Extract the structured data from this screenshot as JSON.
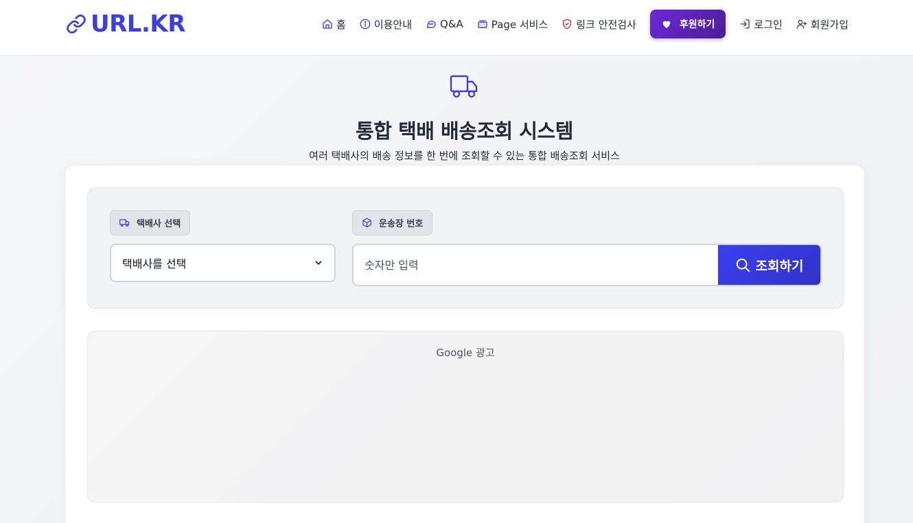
{
  "header": {
    "logo_text": "URL.KR",
    "nav": {
      "home": "홈",
      "guide": "이용안내",
      "qna": "Q&A",
      "page_service": "Page 서비스",
      "link_check": "링크 안전검사",
      "sponsor": "후원하기",
      "login": "로그인",
      "signup": "회원가입"
    }
  },
  "hero": {
    "title": "통합 택배 배송조회 시스템",
    "subtitle": "여러 택배사의 배송 정보를 한 번에 조회할 수 있는 통합 배송조회 서비스"
  },
  "form": {
    "courier_label": "택배사 선택",
    "tracking_label": "운송장 번호",
    "courier_select_value": "택배사를 선택",
    "tracking_placeholder": "숫자만 입력",
    "search_button": "조회하기"
  },
  "ad": {
    "label": "Google 광고"
  },
  "colors": {
    "brand": "#3b3fe0",
    "sponsor": "#5b21b6",
    "search_button": "#3636e0"
  }
}
